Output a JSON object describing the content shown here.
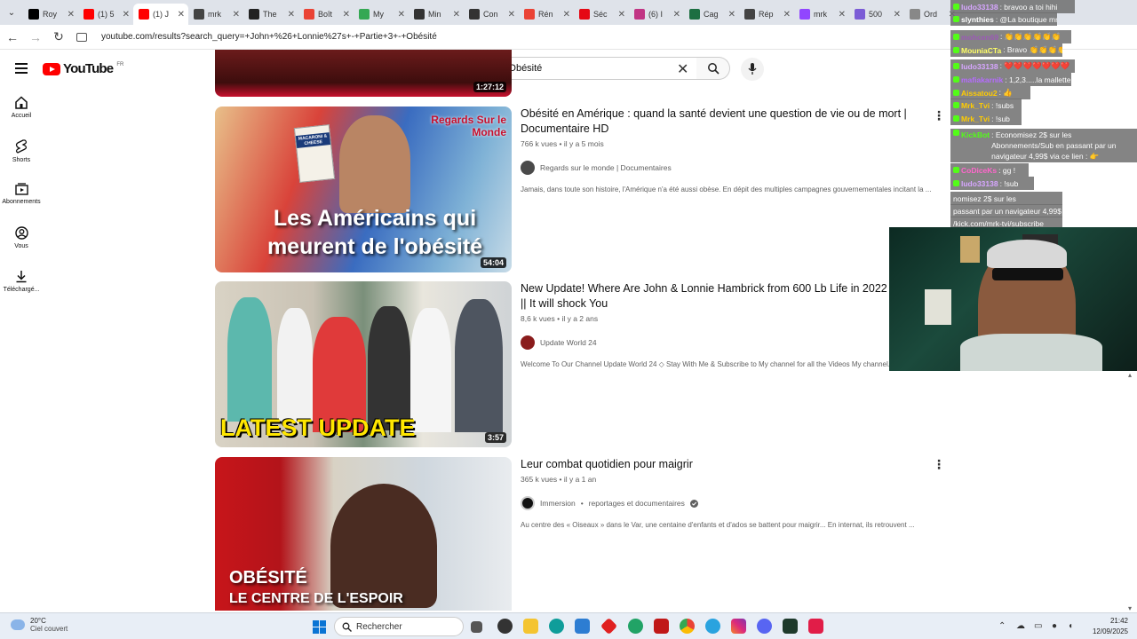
{
  "browser": {
    "tabs": [
      {
        "title": "Roy",
        "color": "#000000"
      },
      {
        "title": "(1) 5",
        "color": "#ff0000"
      },
      {
        "title": "(1) J",
        "color": "#ff0000",
        "active": true
      },
      {
        "title": "mrk",
        "color": "#444444"
      },
      {
        "title": "The",
        "color": "#222222"
      },
      {
        "title": "Boît",
        "color": "#ea4335"
      },
      {
        "title": "My",
        "color": "#34a853"
      },
      {
        "title": "Min",
        "color": "#333333"
      },
      {
        "title": "Con",
        "color": "#333333"
      },
      {
        "title": "Rén",
        "color": "#ea4335"
      },
      {
        "title": "Séc",
        "color": "#e50914"
      },
      {
        "title": "(6) I",
        "color": "#c13584"
      },
      {
        "title": "Cag",
        "color": "#1d6f42"
      },
      {
        "title": "Rép",
        "color": "#444444"
      },
      {
        "title": "mrk",
        "color": "#9146ff"
      },
      {
        "title": "500",
        "color": "#7b5cd6"
      },
      {
        "title": "Ord",
        "color": "#888888"
      }
    ],
    "url": "youtube.com/results?search_query=+John+%26+Lonnie%27s+-+Partie+3+-+Obésité"
  },
  "youtube": {
    "logo": "YouTube",
    "country": "FR",
    "search_value": "John & Lonnie's - Partie 3 - Obésité",
    "sidebar": [
      {
        "label": "Accueil",
        "icon": "home-icon"
      },
      {
        "label": "Shorts",
        "icon": "shorts-icon"
      },
      {
        "label": "Abonnements",
        "icon": "subscriptions-icon"
      },
      {
        "label": "Vous",
        "icon": "you-icon"
      },
      {
        "label": "Téléchargé...",
        "icon": "download-icon"
      }
    ],
    "partial_top_duration": "1:27:12",
    "results": [
      {
        "title": "Obésité en Amérique : quand la santé devient une question de vie ou de mort | Documentaire HD",
        "views": "766 k vues",
        "age": "il y a 5 mois",
        "channel": "Regards sur le monde | Documentaires",
        "description": "Jamais, dans toute son histoire, l'Amérique n'a été aussi obèse. En dépit des multiples campagnes gouvernementales incitant la ...",
        "duration": "54:04",
        "thumb_text": "Les Américains qui meurent de l'obésité",
        "thumb_badge": "Regards Sur le Monde",
        "thumb_pack": "MACARONI & CHEESE"
      },
      {
        "title": "New Update! Where Are John & Lonnie Hambrick from 600 Lb Life in 2022 || It will shock You",
        "views": "8,6 k vues",
        "age": "il y a 2 ans",
        "channel": "Update World 24",
        "description": "Welcome To Our Channel Update World 24 ◇ Stay With Me & Subscribe to My channel for all the Videos My channel.",
        "duration": "3:57",
        "thumb_text": "LATEST UPDATE"
      },
      {
        "title": "Leur combat quotidien pour maigrir",
        "views": "365 k vues",
        "age": "il y a 1 an",
        "channel": "Immersion",
        "channel_extra": "reportages et documentaires",
        "description": "Au centre des « Oiseaux » dans le Var, une centaine d'enfants et d'ados se battent pour maigrir... En internat, ils retrouvent ...",
        "duration": "",
        "thumb_text_1": "OBÉSITÉ",
        "thumb_text_2": "LE CENTRE DE L'ESPOIR"
      }
    ]
  },
  "chat": [
    {
      "user": "ludo33138",
      "text": ": bravoo a toi hihi",
      "color": "#d7a6ff"
    },
    {
      "user": "slynthies",
      "text": ": @La boutique mrk",
      "color": "#ffffff"
    },
    {
      "user": "mohcen69",
      "text": ": 👏👏👏👏👏👏",
      "color": "#9b59b6"
    },
    {
      "user": "MouniaCTa",
      "text": ": Bravo 👏👏👏👏",
      "color": "#ffff66"
    },
    {
      "user": "ludo33138",
      "text": ": ❤️❤️❤️❤️❤️❤️❤️",
      "color": "#d7a6ff"
    },
    {
      "user": "mafiakarnik",
      "text": ": 1,2,3.....la mallette ozbz",
      "color": "#b56bff"
    },
    {
      "user": "Aissatou2",
      "text": ": 👍",
      "color": "#ffcc00"
    },
    {
      "user": "Mrk_Tvi",
      "text": ": !subs",
      "color": "#ffcc00"
    },
    {
      "user": "Mrk_Tvi",
      "text": ": !sub",
      "color": "#ffcc00"
    },
    {
      "user": "KickBot",
      "text": ": Economisez 2$ sur les Abonnements/Sub en passant par un navigateur 4,99$ via ce lien : 👉 https://kick.com/mrk-tvi/subscribe",
      "color": "#53fc18"
    },
    {
      "user": "CoDiceKs",
      "text": ": gg !",
      "color": "#ff66cc"
    },
    {
      "user": "ludo33138",
      "text": ": !sub",
      "color": "#d7a6ff"
    },
    {
      "user": "",
      "text": "nomisez 2$ sur les",
      "color": "#ffffff"
    },
    {
      "user": "",
      "text": "passant par un navigateur 4,99$",
      "color": "#ffffff"
    },
    {
      "user": "",
      "text": "/kick.com/mrk-tvi/subscribe",
      "color": "#ffffff"
    }
  ],
  "taskbar": {
    "temperature": "20°C",
    "weather": "Ciel couvert",
    "search_placeholder": "Rechercher",
    "time": "21:42",
    "date": "12/09/2025"
  }
}
